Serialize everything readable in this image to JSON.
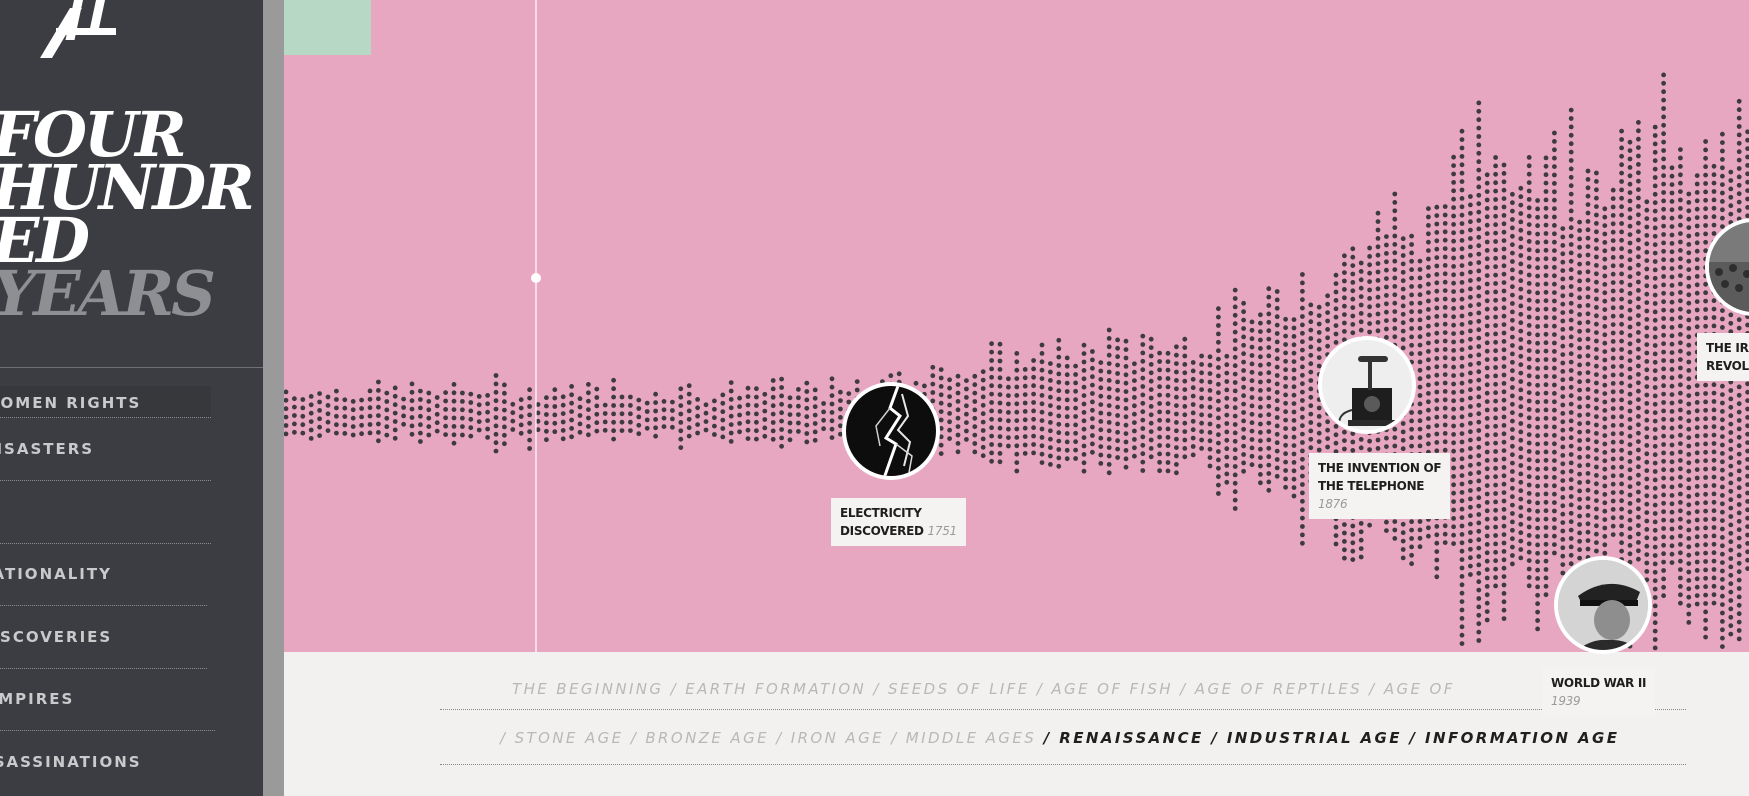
{
  "title": {
    "line1": "FOUR",
    "line2": "HUNDR",
    "line3": "ED",
    "line4": "YEARS"
  },
  "nav": {
    "items": [
      {
        "label": "WOMEN RIGHTS"
      },
      {
        "label": "DISASTERS"
      },
      {
        "label": ""
      },
      {
        "label": "NATIONALITY"
      },
      {
        "label": "DISCOVERIES"
      },
      {
        "label": "EMPIRES"
      },
      {
        "label": "ASSASSINATIONS"
      }
    ]
  },
  "events": [
    {
      "title_line1": "ELECTRICITY",
      "title_line2": "DISCOVERED",
      "year": "1751",
      "icon": "lightning-icon"
    },
    {
      "title_line1": "THE INVENTION OF",
      "title_line2": "THE TELEPHONE",
      "year": "1876",
      "icon": "telephone-icon"
    },
    {
      "title_line1": "WORLD WAR II",
      "title_line2": "",
      "year": "1939",
      "icon": "soldier-portrait-icon"
    },
    {
      "title_line1": "THE IRANIAN",
      "title_line2": "REVOLUTION",
      "year": "",
      "icon": "crowd-icon"
    }
  ],
  "eras": {
    "row1": [
      {
        "label": "THE BEGINNING",
        "active": false
      },
      {
        "label": "EARTH FORMATION",
        "active": false
      },
      {
        "label": "SEEDS OF LIFE",
        "active": false
      },
      {
        "label": "AGE OF FISH",
        "active": false
      },
      {
        "label": "AGE OF REPTILES",
        "active": false
      },
      {
        "label": "AGE OF",
        "active": false
      }
    ],
    "row2": [
      {
        "label": "STONE AGE",
        "active": false
      },
      {
        "label": "BRONZE AGE",
        "active": false
      },
      {
        "label": "IRON AGE",
        "active": false
      },
      {
        "label": "MIDDLE AGES",
        "active": false
      },
      {
        "label": "RENAISSANCE",
        "active": true
      },
      {
        "label": "INDUSTRIAL AGE",
        "active": true
      },
      {
        "label": "INFORMATION AGE",
        "active": true
      }
    ]
  },
  "colors": {
    "sidebar": "#3b3d42",
    "chart_background": "#e8a7c1",
    "dots": "#3d3b3f",
    "accent_tab": "#b7d8c4"
  }
}
